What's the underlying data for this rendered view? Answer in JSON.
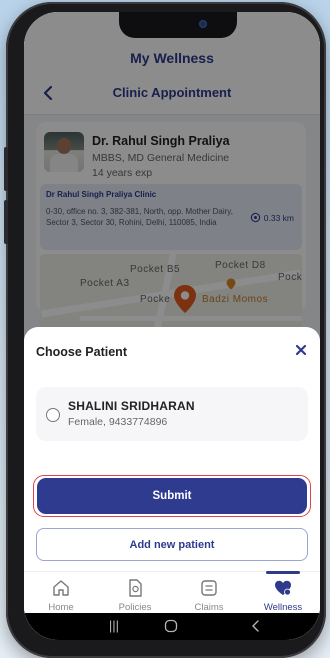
{
  "app": {
    "title": "My Wellness"
  },
  "page": {
    "title": "Clinic Appointment"
  },
  "doctor": {
    "name": "Dr. Rahul Singh Praliya",
    "qualification": "MBBS, MD General Medicine",
    "experience": "14 years exp",
    "clinic_name": "Dr Rahul Singh Praliya Clinic",
    "clinic_address": "0-30, office no. 3, 382-381, North, opp. Mother Dairy, Sector 3, Sector 30, Rohini, Delhi, 110085, India",
    "distance": "0.33 km"
  },
  "map": {
    "labels": [
      "Pocket B5",
      "Pocket D8",
      "Pocket A3",
      "Pock",
      "Pocke",
      "Badzi Momos"
    ]
  },
  "sheet": {
    "title": "Choose Patient",
    "patient": {
      "name": "SHALINI SRIDHARAN",
      "info": "Female, 9433774896"
    },
    "submit_label": "Submit",
    "add_label": "Add new patient"
  },
  "tabs": [
    {
      "label": "Home",
      "icon": "home-icon",
      "active": false
    },
    {
      "label": "Policies",
      "icon": "policies-icon",
      "active": false
    },
    {
      "label": "Claims",
      "icon": "claims-icon",
      "active": false
    },
    {
      "label": "Wellness",
      "icon": "wellness-icon",
      "active": true
    }
  ],
  "colors": {
    "primary": "#2e3b8f",
    "highlight_outline": "#e0434f"
  }
}
